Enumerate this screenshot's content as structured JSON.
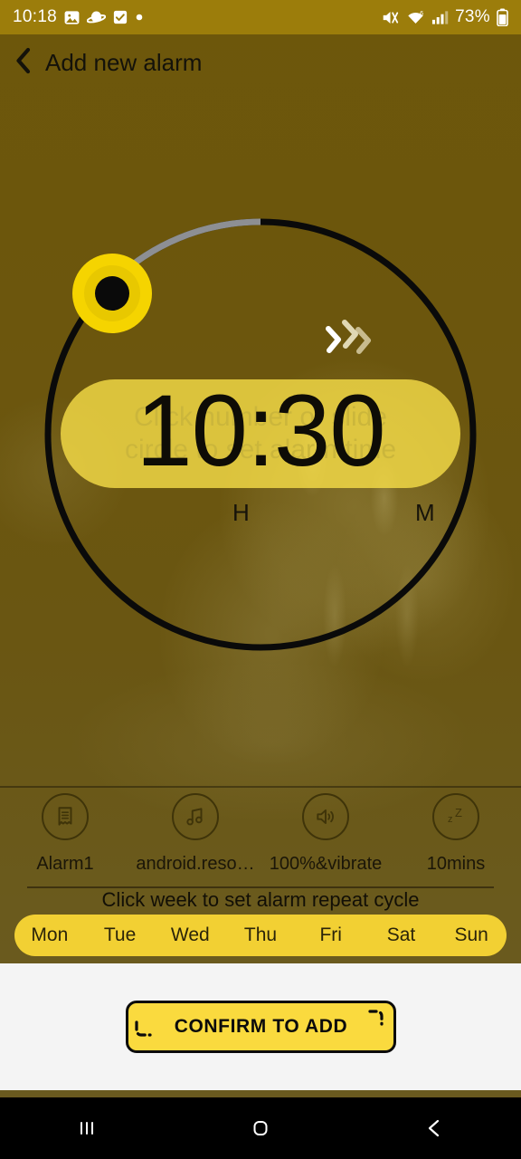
{
  "status_bar": {
    "time": "10:18",
    "battery_percent": "73%",
    "left_icons": [
      "photos-icon",
      "saturn-icon",
      "checkbox-icon",
      "dot-icon"
    ],
    "right_icons": [
      "mute-vibrate-icon",
      "wifi-icon",
      "cellular-signal-icon",
      "battery-icon"
    ]
  },
  "header": {
    "back_icon": "chevron-left-icon",
    "title": "Add new alarm"
  },
  "dial": {
    "hint_line1": "Click number or slide",
    "hint_line2": "circle to set alarm time",
    "time": "10:30",
    "hour_label": "H",
    "minute_label": "M",
    "knob_icon": "dial-knob-handle",
    "arrow_icon": "chevrons-right-icon",
    "ring_color": "#000000",
    "track_color": "#8d8f93",
    "knob_color": "#f5d400"
  },
  "options": [
    {
      "icon": "alarm-label-icon",
      "label": "Alarm1"
    },
    {
      "icon": "music-note-icon",
      "label": "android.reso…"
    },
    {
      "icon": "volume-up-icon",
      "label": "100%&vibrate"
    },
    {
      "icon": "snooze-zzz-icon",
      "label": "10mins"
    }
  ],
  "week": {
    "hint": "Click week to set alarm repeat cycle",
    "days": [
      "Mon",
      "Tue",
      "Wed",
      "Thu",
      "Fri",
      "Sat",
      "Sun"
    ],
    "bar_color": "#f2d033"
  },
  "confirm": {
    "label": "CONFIRM TO ADD",
    "button_color": "#fada3e"
  },
  "nav_bar": {
    "recents_icon": "recents-icon",
    "home_icon": "home-icon",
    "back_icon": "back-icon"
  },
  "theme": {
    "background": "#6b550d",
    "status_bar_bg": "#9c7d0b",
    "accent": "#f7df48",
    "text_dark": "#14120a",
    "confirm_panel_bg": "#f4f4f4"
  }
}
